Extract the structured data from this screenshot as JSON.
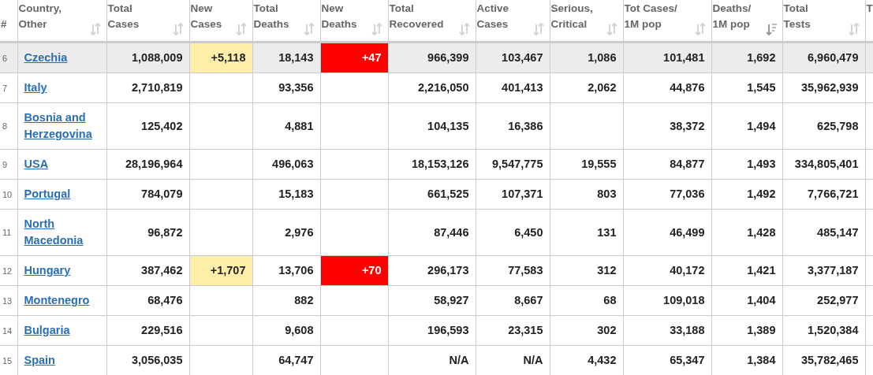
{
  "table": {
    "columns": [
      {
        "label": "#",
        "kind": "rank",
        "sorted": false
      },
      {
        "label": "Country,\nOther",
        "kind": "country",
        "sorted": false
      },
      {
        "label": "Total\nCases",
        "kind": "plain",
        "sorted": false
      },
      {
        "label": "New\nCases",
        "kind": "new_cases",
        "sorted": false
      },
      {
        "label": "Total\nDeaths",
        "kind": "plain",
        "sorted": false
      },
      {
        "label": "New\nDeaths",
        "kind": "new_deaths",
        "sorted": false
      },
      {
        "label": "Total\nRecovered",
        "kind": "plain",
        "sorted": false
      },
      {
        "label": "Active\nCases",
        "kind": "plain",
        "sorted": false
      },
      {
        "label": "Serious,\nCritical",
        "kind": "plain",
        "sorted": false
      },
      {
        "label": "Tot Cases/\n1M pop",
        "kind": "plain",
        "sorted": false
      },
      {
        "label": "Deaths/\n1M pop",
        "kind": "plain",
        "sorted": true
      },
      {
        "label": "Total\nTests",
        "kind": "plain",
        "sorted": false
      },
      {
        "label": "T",
        "kind": "cut",
        "sorted": false
      }
    ],
    "rows": [
      {
        "highlighted": true,
        "cells": [
          "6",
          "Czechia",
          "1,088,009",
          "+5,118",
          "18,143",
          "+47",
          "966,399",
          "103,467",
          "1,086",
          "101,481",
          "1,692",
          "6,960,479"
        ]
      },
      {
        "highlighted": false,
        "cells": [
          "7",
          "Italy",
          "2,710,819",
          null,
          "93,356",
          null,
          "2,216,050",
          "401,413",
          "2,062",
          "44,876",
          "1,545",
          "35,962,939"
        ]
      },
      {
        "highlighted": false,
        "cells": [
          "8",
          "Bosnia and Herzegovina",
          "125,402",
          null,
          "4,881",
          null,
          "104,135",
          "16,386",
          null,
          "38,372",
          "1,494",
          "625,798"
        ]
      },
      {
        "highlighted": false,
        "cells": [
          "9",
          "USA",
          "28,196,964",
          null,
          "496,063",
          null,
          "18,153,126",
          "9,547,775",
          "19,555",
          "84,877",
          "1,493",
          "334,805,401"
        ]
      },
      {
        "highlighted": false,
        "cells": [
          "10",
          "Portugal",
          "784,079",
          null,
          "15,183",
          null,
          "661,525",
          "107,371",
          "803",
          "77,036",
          "1,492",
          "7,766,721"
        ]
      },
      {
        "highlighted": false,
        "cells": [
          "11",
          "North Macedonia",
          "96,872",
          null,
          "2,976",
          null,
          "87,446",
          "6,450",
          "131",
          "46,499",
          "1,428",
          "485,147"
        ]
      },
      {
        "highlighted": false,
        "cells": [
          "12",
          "Hungary",
          "387,462",
          "+1,707",
          "13,706",
          "+70",
          "296,173",
          "77,583",
          "312",
          "40,172",
          "1,421",
          "3,377,187"
        ]
      },
      {
        "highlighted": false,
        "cells": [
          "13",
          "Montenegro",
          "68,476",
          null,
          "882",
          null,
          "58,927",
          "8,667",
          "68",
          "109,018",
          "1,404",
          "252,977"
        ]
      },
      {
        "highlighted": false,
        "cells": [
          "14",
          "Bulgaria",
          "229,516",
          null,
          "9,608",
          null,
          "196,593",
          "23,315",
          "302",
          "33,188",
          "1,389",
          "1,520,384"
        ]
      },
      {
        "highlighted": false,
        "cells": [
          "15",
          "Spain",
          "3,056,035",
          null,
          "64,747",
          null,
          "N/A",
          "N/A",
          "4,432",
          "65,347",
          "1,384",
          "35,782,465"
        ]
      }
    ]
  }
}
